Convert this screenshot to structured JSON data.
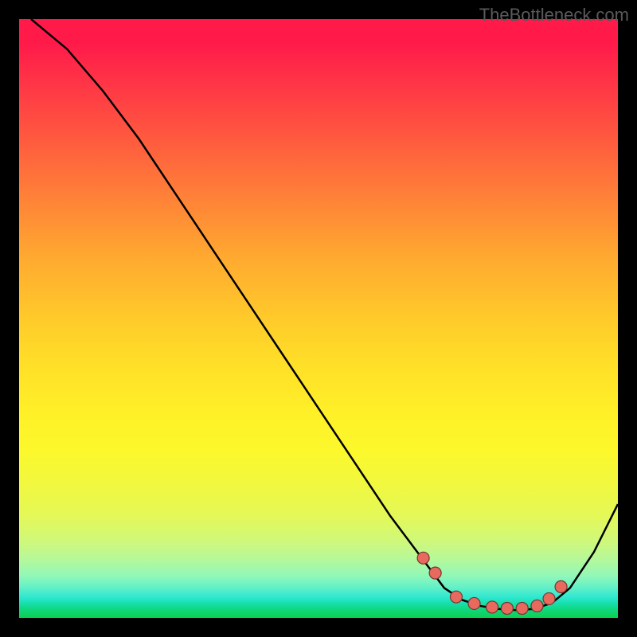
{
  "watermark": "TheBottleneck.com",
  "chart_data": {
    "type": "line",
    "title": "",
    "xlabel": "",
    "ylabel": "",
    "xlim": [
      0,
      100
    ],
    "ylim": [
      0,
      100
    ],
    "series": [
      {
        "name": "bottleneck-curve",
        "x": [
          2,
          8,
          14,
          20,
          26,
          32,
          38,
          44,
          50,
          56,
          62,
          68,
          71,
          74,
          77,
          80,
          83,
          86,
          89,
          92,
          96,
          100
        ],
        "y": [
          100,
          95,
          88,
          80,
          71,
          62,
          53,
          44,
          35,
          26,
          17,
          9,
          5,
          3,
          2,
          1.5,
          1.3,
          1.5,
          2.5,
          5,
          11,
          19
        ]
      }
    ],
    "markers": {
      "name": "highlight-dots",
      "x": [
        67.5,
        69.5,
        73,
        76,
        79,
        81.5,
        84,
        86.5,
        88.5,
        90.5
      ],
      "y": [
        10,
        7.5,
        3.5,
        2.4,
        1.8,
        1.6,
        1.6,
        2.0,
        3.2,
        5.2
      ]
    }
  }
}
